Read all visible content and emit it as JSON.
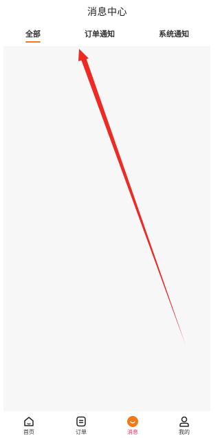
{
  "header": {
    "title": "消息中心"
  },
  "tabs": [
    {
      "label": "全部",
      "active": true
    },
    {
      "label": "订单通知",
      "active": false
    },
    {
      "label": "系统通知",
      "active": false
    }
  ],
  "tabbar": [
    {
      "label": "首页",
      "icon": "home-icon",
      "active": false
    },
    {
      "label": "订单",
      "icon": "order-icon",
      "active": false
    },
    {
      "label": "消息",
      "icon": "message-icon",
      "active": true
    },
    {
      "label": "我的",
      "icon": "profile-icon",
      "active": false
    }
  ],
  "colors": {
    "accent_orange": "#f07a1a",
    "active_label": "#e8325c",
    "content_bg": "#f7f7f7",
    "annotation_red": "#ee2a24"
  }
}
